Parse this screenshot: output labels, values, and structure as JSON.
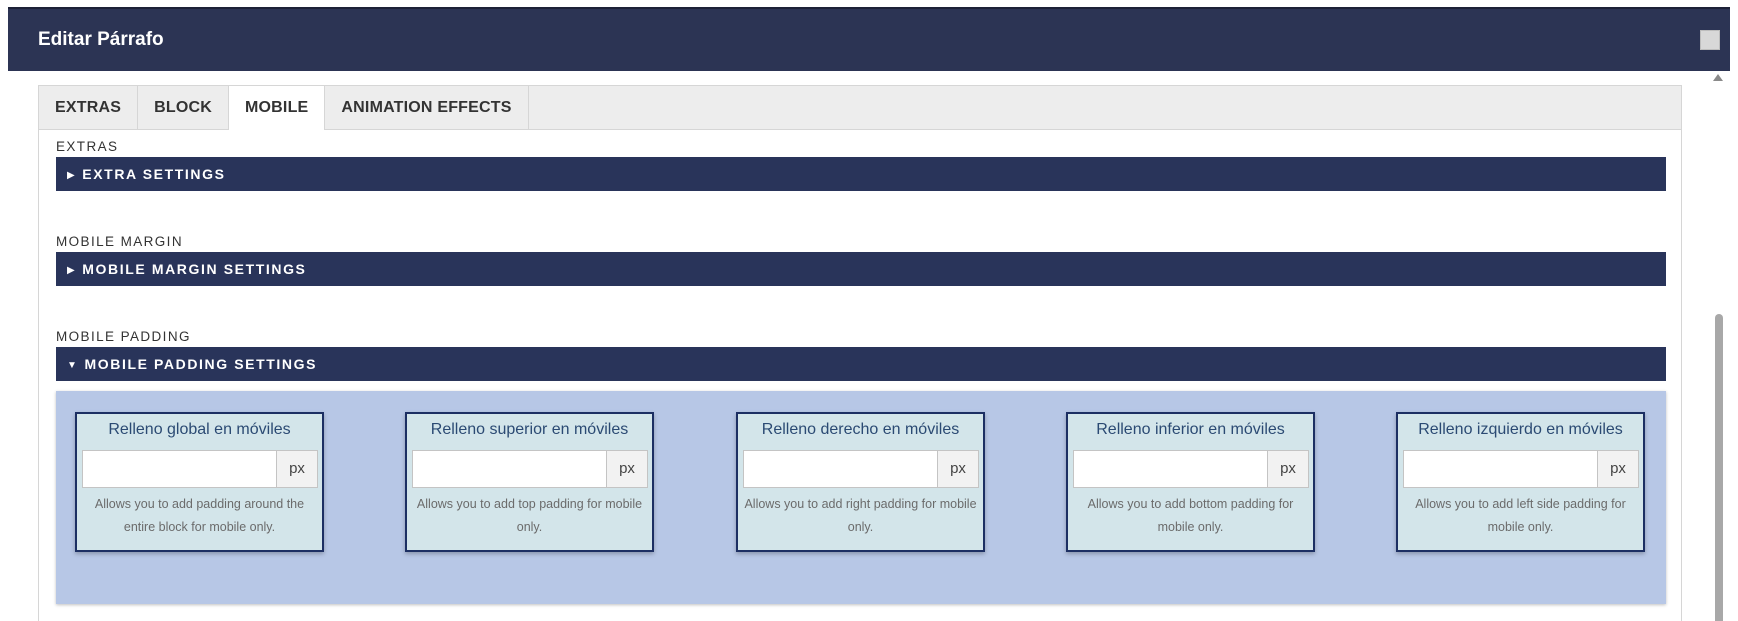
{
  "dialog": {
    "title": "Editar Párrafo"
  },
  "tabs": [
    {
      "label": "EXTRAS",
      "active": false
    },
    {
      "label": "BLOCK",
      "active": false
    },
    {
      "label": "MOBILE",
      "active": true
    },
    {
      "label": "ANIMATION EFFECTS",
      "active": false
    }
  ],
  "sections": [
    {
      "label": "EXTRAS",
      "bar_label": "EXTRA SETTINGS",
      "expanded": false
    },
    {
      "label": "MOBILE MARGIN",
      "bar_label": "MOBILE MARGIN SETTINGS",
      "expanded": false
    },
    {
      "label": "MOBILE PADDING",
      "bar_label": "MOBILE PADDING SETTINGS",
      "expanded": true
    }
  ],
  "carets": {
    "collapsed": "▶",
    "expanded": "▼"
  },
  "padding_fields": [
    {
      "title": "Relleno global en móviles",
      "value": "",
      "unit": "px",
      "help": "Allows you to add padding around the entire block for mobile only."
    },
    {
      "title": "Relleno superior en móviles",
      "value": "",
      "unit": "px",
      "help": "Allows you to add top padding for mobile only."
    },
    {
      "title": "Relleno derecho en móviles",
      "value": "",
      "unit": "px",
      "help": "Allows you to add right padding for mobile only."
    },
    {
      "title": "Relleno inferior en móviles",
      "value": "",
      "unit": "px",
      "help": "Allows you to add bottom padding for mobile only."
    },
    {
      "title": "Relleno izquierdo en móviles",
      "value": "",
      "unit": "px",
      "help": "Allows you to add left side padding for mobile only."
    }
  ],
  "colors": {
    "titlebar": "#2c3454",
    "section_bar": "#29345a",
    "padding_area": "#b7c7e6",
    "field_box": "#d3e5ea",
    "field_border": "#1c2f63"
  }
}
